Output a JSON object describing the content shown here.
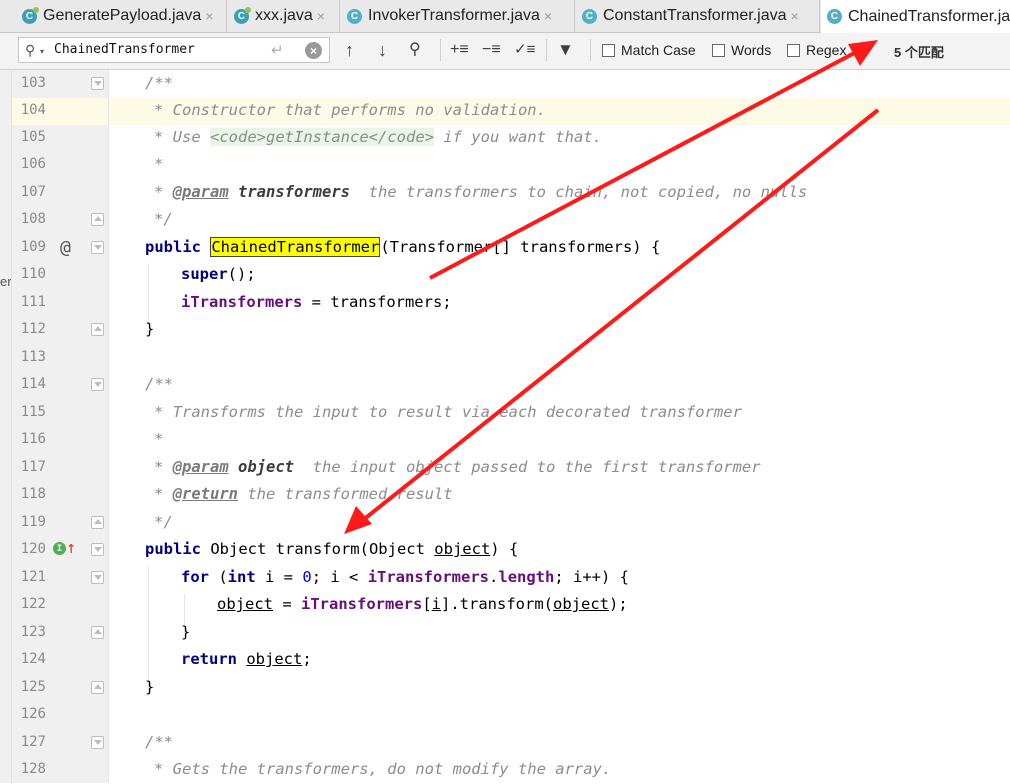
{
  "tabs": [
    {
      "label": "GeneratePayload.java",
      "close": "×"
    },
    {
      "label": "xxx.java",
      "close": "×"
    },
    {
      "label": "InvokerTransformer.java",
      "close": "×"
    },
    {
      "label": "ConstantTransformer.java",
      "close": "×"
    },
    {
      "label": "ChainedTransformer.java",
      "close": ""
    }
  ],
  "search": {
    "value": "ChainedTransformer",
    "match_case_label": "Match Case",
    "words_label": "Words",
    "regex_label": "Regex",
    "match_count": "5 个匹配"
  },
  "editor": {
    "current_line": 104,
    "side_fragment": "er",
    "line_numbers": [
      103,
      104,
      105,
      106,
      107,
      108,
      109,
      110,
      111,
      112,
      113,
      114,
      115,
      116,
      117,
      118,
      119,
      120,
      121,
      122,
      123,
      124,
      125,
      126,
      127,
      128
    ],
    "lines": {
      "l103": "/**",
      "l104": "* Constructor that performs no validation.",
      "l105a": "* Use ",
      "l105b": "<code>",
      "l105c": "getInstance",
      "l105d": "</code>",
      "l105e": " if you want that.",
      "l106": "*",
      "l107a": "* ",
      "l107b": "@param",
      "l107c": " transformers",
      "l107d": "  the transformers to chain, not copied, no nulls",
      "l108": "*/",
      "l109a": "public",
      "l109b": " ",
      "l109c": "ChainedTransformer",
      "l109d": "(Transformer[] transformers) {",
      "l110a": "super",
      "l110b": "();",
      "l111a": "iTransformers",
      "l111b": " = transformers;",
      "l112": "}",
      "l114": "/**",
      "l115": "* Transforms the input to result via each decorated transformer",
      "l116": "*",
      "l117a": "* ",
      "l117b": "@param",
      "l117c": " object",
      "l117d": "  the input object passed to the first transformer",
      "l118a": "* ",
      "l118b": "@return",
      "l118c": " the transformed result",
      "l119": "*/",
      "l120a": "public",
      "l120b": " Object transform(Object ",
      "l120c": "object",
      "l120d": ") {",
      "l121a": "for",
      "l121b": " (",
      "l121c": "int",
      "l121d": " i = ",
      "l121e": "0",
      "l121f": "; i < ",
      "l121g": "iTransformers",
      "l121h": ".",
      "l121i": "length",
      "l121j": "; i++) {",
      "l122a": "object",
      "l122b": " = ",
      "l122c": "iTransformers",
      "l122d": "[",
      "l122e": "i",
      "l122f": "].transform(",
      "l122g": "object",
      "l122h": ");",
      "l123": "}",
      "l124a": "return",
      "l124b": " ",
      "l124c": "object",
      "l124d": ";",
      "l125": "}",
      "l127": "/**",
      "l128": "* Gets the transformers, do not modify the array."
    }
  },
  "colors": {
    "keyword": "#000080",
    "field": "#660e7a",
    "comment": "#8c8c8c",
    "search_highlight": "#ffff00",
    "annotation_arrow": "#ff1a1a"
  }
}
